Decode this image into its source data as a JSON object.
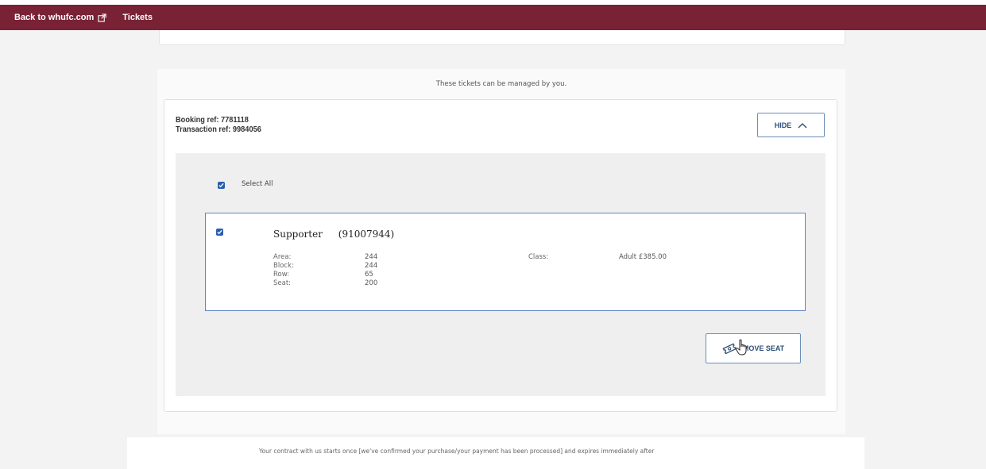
{
  "topbar": {
    "back_link": "Back to whufc.com",
    "tickets_link": "Tickets",
    "brand_color": "#7a2235"
  },
  "panel": {
    "managed_note": "These tickets can be managed by you."
  },
  "booking": {
    "booking_ref": "Booking ref: 7781118",
    "transaction_ref": "Transaction ref: 9984056",
    "hide_label": "HIDE"
  },
  "selection": {
    "select_all_label": "Select All",
    "select_all_checked": true
  },
  "ticket": {
    "type": "Supporter",
    "id": "(91007944)",
    "checked": true,
    "fields": [
      {
        "label": "Area:",
        "value": "244"
      },
      {
        "label": "Block:",
        "value": "244"
      },
      {
        "label": "Row:",
        "value": "65"
      },
      {
        "label": "Seat:",
        "value": "200"
      }
    ],
    "class_label": "Class:",
    "class_value": "Adult £385.00"
  },
  "actions": {
    "move_seat_label": "MOVE SEAT"
  },
  "footer": {
    "contract_text": "Your contract with us starts once [we've confirmed your purchase/your payment has been processed] and expires immediately after"
  },
  "colors": {
    "accent": "#2e4f78",
    "checkbox": "#2a5fb0",
    "card_border": "#5a86c4"
  }
}
